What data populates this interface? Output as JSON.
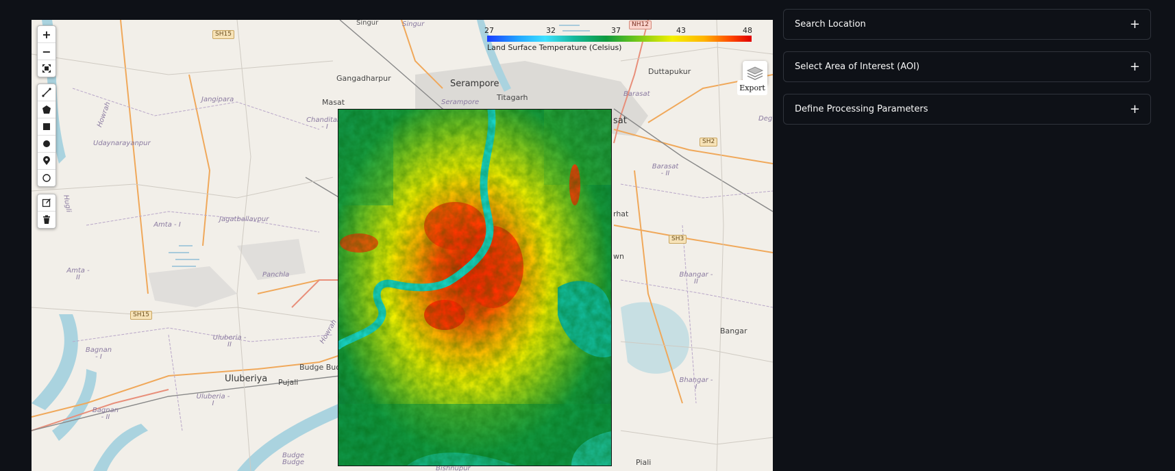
{
  "map": {
    "zoom_in": "+",
    "zoom_out": "−",
    "legend": {
      "ticks": [
        "27",
        "32",
        "37",
        "43",
        "48"
      ],
      "title": "Land Surface Temperature (Celsius)"
    },
    "export_label": "Export",
    "places": [
      {
        "name": "Singur",
        "cls": "city"
      },
      {
        "name": "Singur",
        "cls": "it"
      },
      {
        "name": "SH15",
        "cls": "road-shield"
      },
      {
        "name": "NH12",
        "cls": "road-shield nh"
      },
      {
        "name": "Gangadharpur",
        "cls": "city"
      },
      {
        "name": "Serampore",
        "cls": "big"
      },
      {
        "name": "Duttapukur",
        "cls": "city"
      },
      {
        "name": "Titagarh",
        "cls": "city"
      },
      {
        "name": "Masat",
        "cls": "city"
      },
      {
        "name": "Serampore",
        "cls": "it"
      },
      {
        "name": "Barasat",
        "cls": "it"
      },
      {
        "name": "Jangipara",
        "cls": "it"
      },
      {
        "name": "Chanditala - I",
        "cls": "it"
      },
      {
        "name": "Deg",
        "cls": "it"
      },
      {
        "name": "Udaynarayanpur",
        "cls": "it"
      },
      {
        "name": "Howrah",
        "cls": "it"
      },
      {
        "name": "Hugli",
        "cls": "it"
      },
      {
        "name": "SH2",
        "cls": "road-shield"
      },
      {
        "name": "Barasat - II",
        "cls": "it"
      },
      {
        "name": "Jagatballavpur",
        "cls": "it"
      },
      {
        "name": "Amta - I",
        "cls": "it"
      },
      {
        "name": "SH3",
        "cls": "road-shield"
      },
      {
        "name": "Amta - II",
        "cls": "it"
      },
      {
        "name": "Panchla",
        "cls": "it"
      },
      {
        "name": "Bhangar - II",
        "cls": "it"
      },
      {
        "name": "SH15",
        "cls": "road-shield"
      },
      {
        "name": "Bangar",
        "cls": "city"
      },
      {
        "name": "Uluberia - II",
        "cls": "it"
      },
      {
        "name": "Bagnan - I",
        "cls": "it"
      },
      {
        "name": "Budge Bud",
        "cls": "city"
      },
      {
        "name": "Uluberiya",
        "cls": "big"
      },
      {
        "name": "Pujali",
        "cls": "city"
      },
      {
        "name": "Bhangar - I",
        "cls": "it"
      },
      {
        "name": "Uluberia - I",
        "cls": "it"
      },
      {
        "name": "Bagnan - II",
        "cls": "it"
      },
      {
        "name": "Budge Budge",
        "cls": "it"
      },
      {
        "name": "Piali",
        "cls": "city"
      },
      {
        "name": "Bishnupur",
        "cls": "it"
      },
      {
        "name": "sat",
        "cls": "big"
      },
      {
        "name": "rhat",
        "cls": "city"
      },
      {
        "name": "wn",
        "cls": "city"
      },
      {
        "name": "Howrah",
        "cls": "it"
      }
    ]
  },
  "panels": [
    {
      "label": "Search Location",
      "icon": "+"
    },
    {
      "label": "Select Area of Interest (AOI)",
      "icon": "+"
    },
    {
      "label": "Define Processing Parameters",
      "icon": "+"
    }
  ]
}
